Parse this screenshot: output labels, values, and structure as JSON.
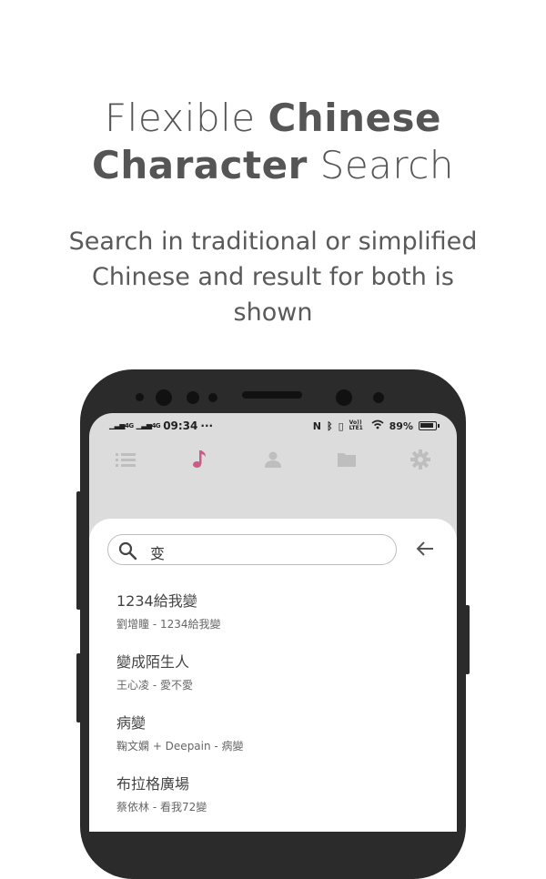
{
  "headline": {
    "line1_light": "Flexible",
    "line1_bold": "Chinese",
    "line2_bold": "Character",
    "line2_light": "Search"
  },
  "subhead": "Search in traditional or simplified Chinese and result for both is shown",
  "statusbar": {
    "net1": "4G",
    "net2": "4G",
    "time": "09:34",
    "more": "···",
    "volte": "Vo)) LTE1",
    "battery": "89%"
  },
  "tabs": [
    {
      "icon": "list-icon"
    },
    {
      "icon": "music-note-icon"
    },
    {
      "icon": "person-icon"
    },
    {
      "icon": "folder-icon"
    },
    {
      "icon": "gear-icon"
    }
  ],
  "search": {
    "value": "变"
  },
  "results": [
    {
      "title": "1234給我變",
      "subtitle": "劉增瞳 - 1234給我變"
    },
    {
      "title": "變成陌生人",
      "subtitle": "王心凌 - 愛不愛"
    },
    {
      "title": "病變",
      "subtitle": "鞠文嫻 + Deepain - 病變"
    },
    {
      "title": "布拉格廣場",
      "subtitle": "蔡依林 - 看我72變"
    }
  ],
  "colors": {
    "accent": "#c2185b",
    "phone": "#2b2b2b",
    "backdrop": "#dcdcdc"
  }
}
